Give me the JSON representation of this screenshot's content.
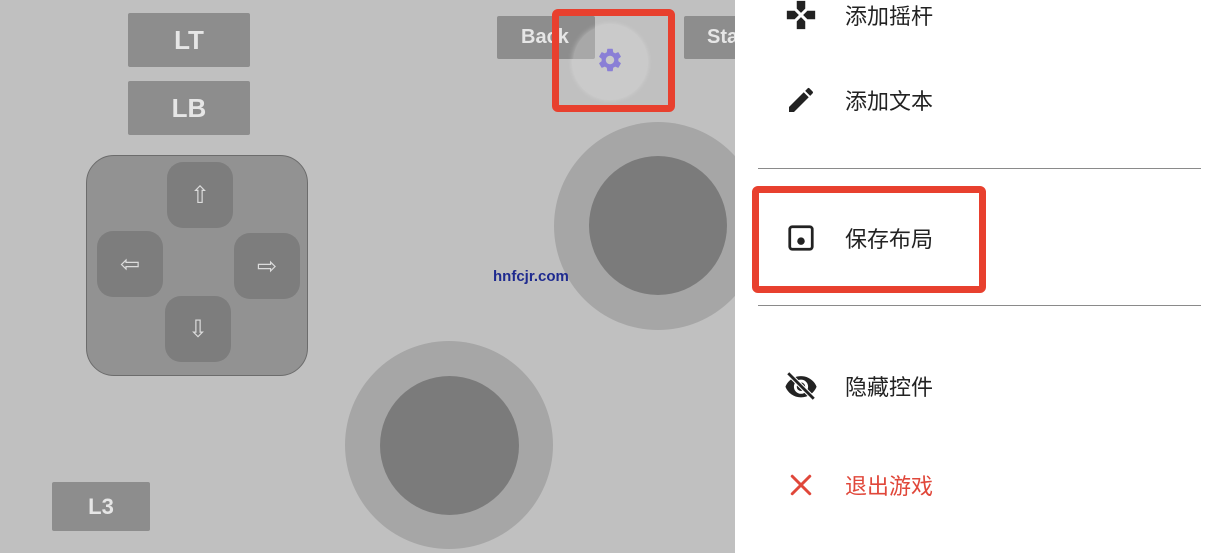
{
  "controller": {
    "lt_label": "LT",
    "lb_label": "LB",
    "l3_label": "L3",
    "back_label": "Back",
    "start_label": "Start",
    "dpad": {
      "up": "⇧",
      "down": "⇩",
      "left": "⇦",
      "right": "⇨"
    }
  },
  "watermark": "hnfcjr.com",
  "menu": {
    "items": [
      {
        "label": "添加摇杆",
        "icon": "gamepad-icon"
      },
      {
        "label": "添加文本",
        "icon": "pencil-icon"
      },
      {
        "label": "保存布局",
        "icon": "save-icon"
      },
      {
        "label": "隐藏控件",
        "icon": "eye-off-icon"
      },
      {
        "label": "退出游戏",
        "icon": "close-icon"
      }
    ]
  },
  "colors": {
    "highlight": "#e8402e",
    "gear": "#8a7fd6",
    "exit": "#e0473a"
  }
}
